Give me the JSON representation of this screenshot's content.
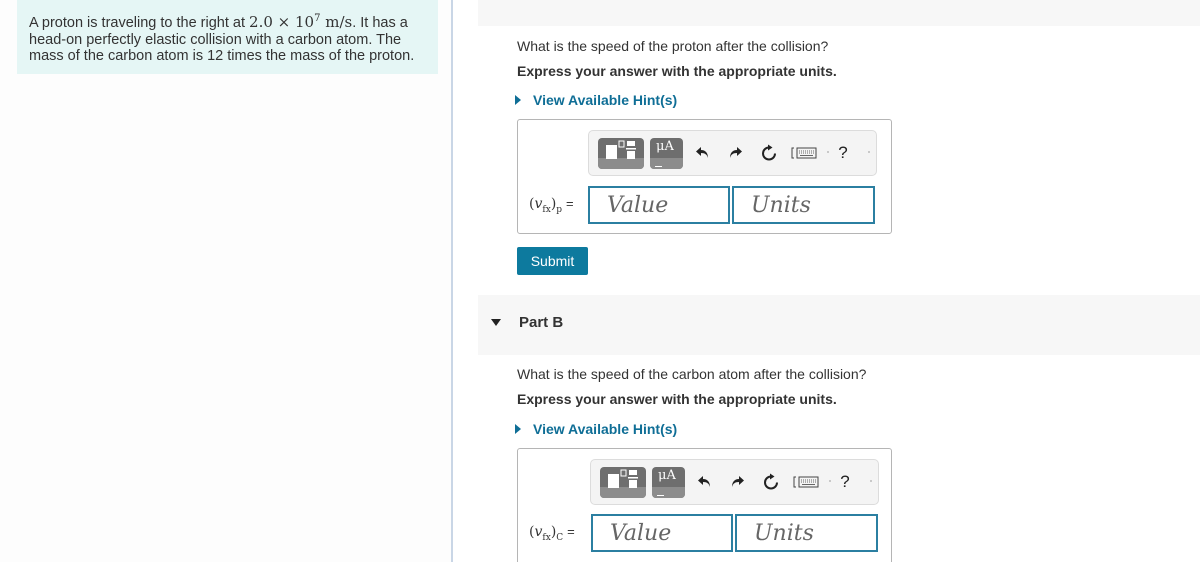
{
  "problem": {
    "text_before": "A proton is traveling to the right at ",
    "math": "2.0 × 10",
    "exponent": "7",
    "unit": " m/s",
    "text_after": ". It has a head-on perfectly elastic collision with a carbon atom. The mass of the carbon atom is 12 times the mass of the proton."
  },
  "part_a": {
    "question": "What is the speed of the proton after the collision?",
    "instruction": "Express your answer with the appropriate units.",
    "hint_link": "View Available Hint(s)",
    "var_base": "v",
    "var_sub": "fx",
    "var_subject": "p",
    "equals": "=",
    "value_placeholder": "Value",
    "units_placeholder": "Units",
    "submit_label": "Submit"
  },
  "part_b": {
    "title": "Part B",
    "question": "What is the speed of the carbon atom after the collision?",
    "instruction": "Express your answer with the appropriate units.",
    "hint_link": "View Available Hint(s)",
    "var_base": "v",
    "var_sub": "fx",
    "var_subject": "C",
    "equals": "=",
    "value_placeholder": "Value",
    "units_placeholder": "Units"
  },
  "toolbar": {
    "templates_icon": "templates-icon",
    "units_label": "μA",
    "undo_icon": "↶",
    "redo_icon": "↷",
    "reset_icon": "↻",
    "keyboard_icon": "keyboard-icon",
    "help_label": "?"
  },
  "colors": {
    "accent": "#0f6e96",
    "submit_bg": "#0d7a9e",
    "field_border": "#2b7fa1",
    "problem_bg": "#e5f6f5",
    "band_bg": "#f7f7f7"
  }
}
